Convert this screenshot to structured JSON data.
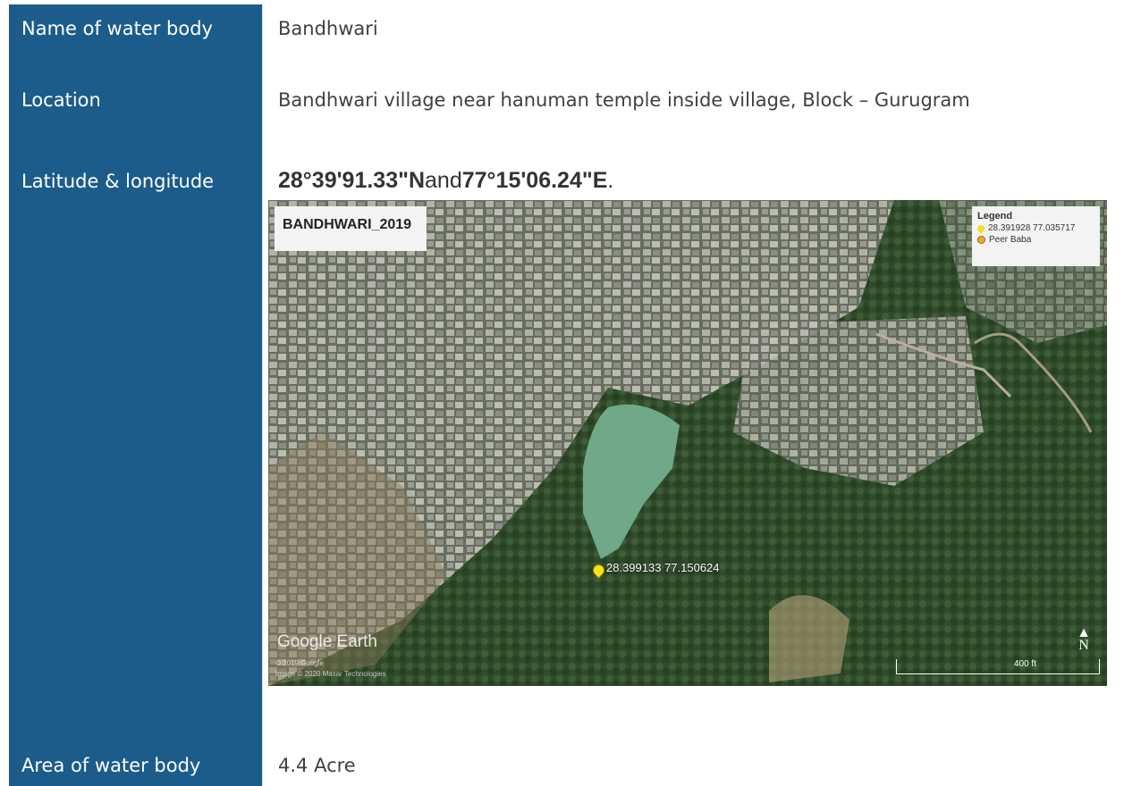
{
  "table": {
    "rows": [
      {
        "label": "Name of water body",
        "value": "Bandhwari"
      },
      {
        "label": "Location",
        "value": "Bandhwari village near hanuman temple inside village, Block – Gurugram"
      },
      {
        "label": "Latitude & longitude",
        "value": ""
      },
      {
        "label": "Area of water body",
        "value": "4.4 Acre"
      }
    ]
  },
  "coordinates": {
    "lat": "28°39'91.33\"N",
    "joiner": "and",
    "lon": "77°15'06.24\"E",
    "end": "."
  },
  "map": {
    "title": "BANDHWARI_2019",
    "legend_title": "Legend",
    "legend_items": [
      "28.391928 77.035717",
      "Peer Baba"
    ],
    "pin_label": "28.399133  77.150624",
    "watermark": "Google Earth",
    "credit1": "© 2019 Google",
    "credit2": "Image © 2020 Maxar Technologies",
    "north": "N",
    "scale": "400 ft"
  }
}
